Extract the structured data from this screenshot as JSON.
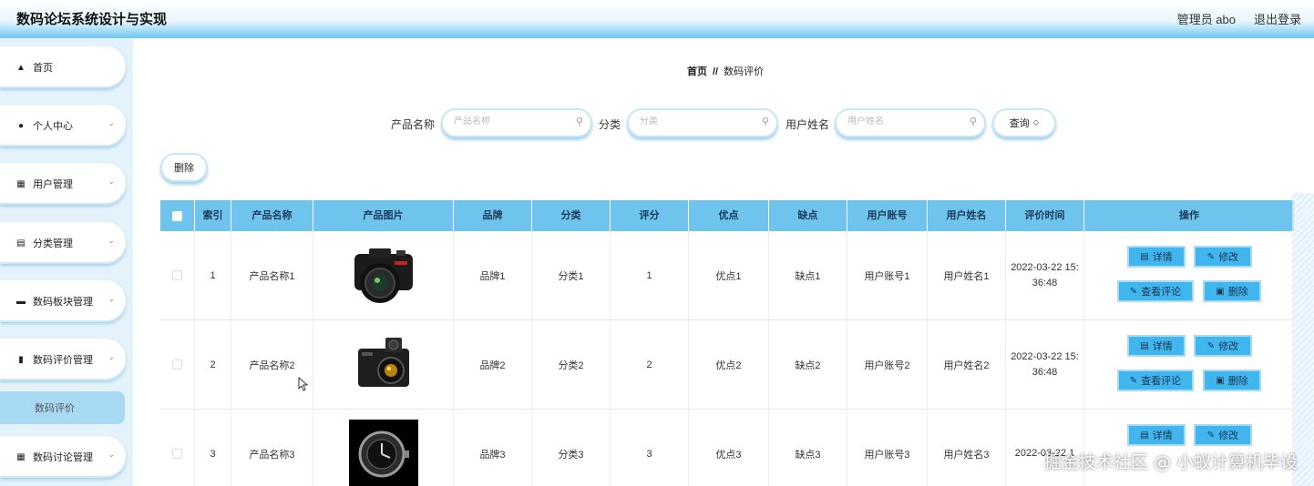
{
  "header": {
    "title": "数码论坛系统设计与实现",
    "user": "管理员 abo",
    "logout": "退出登录"
  },
  "sidebar": {
    "items": [
      {
        "label": "首页",
        "icon": "home-icon"
      },
      {
        "label": "个人中心",
        "icon": "person-icon"
      },
      {
        "label": "用户管理",
        "icon": "grid-icon"
      },
      {
        "label": "分类管理",
        "icon": "bars-icon"
      },
      {
        "label": "数码板块管理",
        "icon": "ticket-icon"
      },
      {
        "label": "数码评价管理",
        "icon": "chart-icon"
      },
      {
        "label": "数码讨论管理",
        "icon": "grid-icon"
      }
    ],
    "active_sub": "数码评价"
  },
  "breadcrumb": {
    "home": "首页",
    "sep": "//",
    "current": "数码评价"
  },
  "search": {
    "product_name": {
      "label": "产品名称",
      "placeholder": "产品名称"
    },
    "category": {
      "label": "分类",
      "placeholder": "分类"
    },
    "user_name": {
      "label": "用户姓名",
      "placeholder": "用户姓名"
    },
    "query_label": "查询"
  },
  "delete_label": "删除",
  "table": {
    "headers": [
      "索引",
      "产品名称",
      "产品图片",
      "品牌",
      "分类",
      "评分",
      "优点",
      "缺点",
      "用户账号",
      "用户姓名",
      "评价时间",
      "操作"
    ],
    "rows": [
      {
        "index": "1",
        "name": "产品名称1",
        "image": "camera-dslr",
        "brand": "品牌1",
        "category": "分类1",
        "rating": "1",
        "pros": "优点1",
        "cons": "缺点1",
        "account": "用户账号1",
        "username": "用户姓名1",
        "time": "2022-03-22 15:36:48"
      },
      {
        "index": "2",
        "name": "产品名称2",
        "image": "camera-compact",
        "brand": "品牌2",
        "category": "分类2",
        "rating": "2",
        "pros": "优点2",
        "cons": "缺点2",
        "account": "用户账号2",
        "username": "用户姓名2",
        "time": "2022-03-22 15:36:48"
      },
      {
        "index": "3",
        "name": "产品名称3",
        "image": "watch",
        "brand": "品牌3",
        "category": "分类3",
        "rating": "3",
        "pros": "优点3",
        "cons": "缺点3",
        "account": "用户账号3",
        "username": "用户姓名3",
        "time": "2022-03-22 1"
      }
    ],
    "actions": {
      "detail": "详情",
      "edit": "修改",
      "view_comments": "查看评论",
      "delete": "删除"
    }
  },
  "watermark": "掘金技术社区 @ 小蚁计算机毕设",
  "colors": {
    "header_accent": "#6cc6f2",
    "table_header": "#6ec4ec",
    "action_button": "#40b5ee",
    "sidebar_bg": "#e3f2fb"
  }
}
